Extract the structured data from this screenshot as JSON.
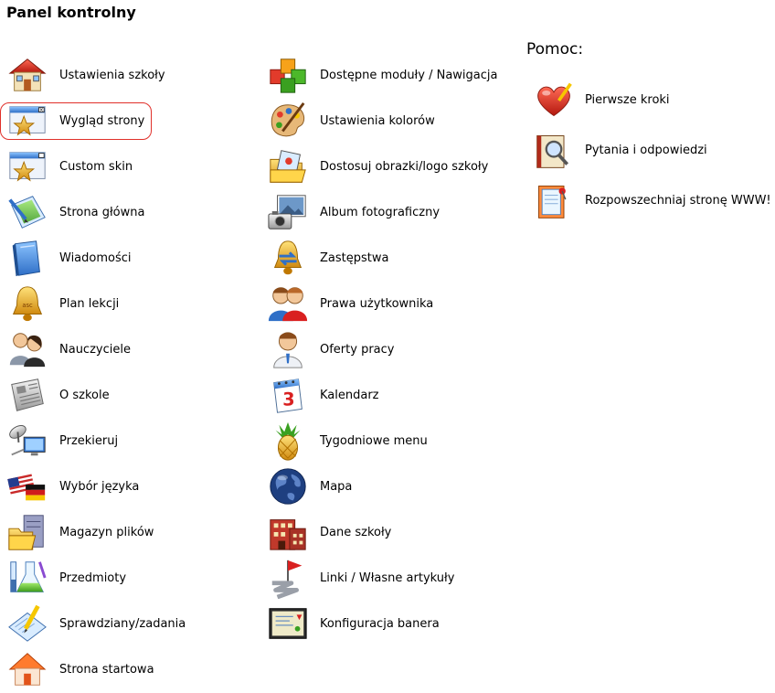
{
  "page": {
    "title": "Panel kontrolny"
  },
  "help": {
    "heading": "Pomoc:",
    "items": [
      {
        "label": "Pierwsze kroki",
        "icon": "heart-pencil-icon"
      },
      {
        "label": "Pytania i odpowiedzi",
        "icon": "book-magnifier-icon"
      },
      {
        "label": "Rozpowszechniaj stronę WWW!",
        "icon": "notepad-pin-icon"
      }
    ]
  },
  "column1": [
    {
      "label": "Ustawienia szkoły",
      "icon": "house-icon"
    },
    {
      "label": "Wygląd strony",
      "icon": "window-star-icon",
      "highlighted": true
    },
    {
      "label": "Custom skin",
      "icon": "window-star-icon"
    },
    {
      "label": "Strona główna",
      "icon": "document-pencil-icon"
    },
    {
      "label": "Wiadomości",
      "icon": "blue-book-icon"
    },
    {
      "label": "Plan lekcji",
      "icon": "bell-icon"
    },
    {
      "label": "Nauczyciele",
      "icon": "people-icon"
    },
    {
      "label": "O szkole",
      "icon": "newspaper-icon"
    },
    {
      "label": "Przekieruj",
      "icon": "satellite-monitor-icon"
    },
    {
      "label": "Wybór języka",
      "icon": "flags-icon"
    },
    {
      "label": "Magazyn plików",
      "icon": "file-server-icon"
    },
    {
      "label": "Przedmioty",
      "icon": "flask-pencil-icon"
    },
    {
      "label": "Sprawdziany/zadania",
      "icon": "paper-pencil-icon"
    },
    {
      "label": "Strona startowa",
      "icon": "house-icon"
    }
  ],
  "column2": [
    {
      "label": "Dostępne moduły / Nawigacja",
      "icon": "cubes-icon"
    },
    {
      "label": "Ustawienia kolorów",
      "icon": "palette-icon"
    },
    {
      "label": "Dostosuj obrazki/logo szkoły",
      "icon": "folder-image-icon"
    },
    {
      "label": "Album fotograficzny",
      "icon": "camera-photo-icon"
    },
    {
      "label": "Zastępstwa",
      "icon": "bell-arrows-icon"
    },
    {
      "label": "Prawa użytkownika",
      "icon": "users-icon"
    },
    {
      "label": "Oferty pracy",
      "icon": "worker-icon"
    },
    {
      "label": "Kalendarz",
      "icon": "calendar-icon"
    },
    {
      "label": "Tygodniowe menu",
      "icon": "pineapple-icon"
    },
    {
      "label": "Mapa",
      "icon": "globe-icon"
    },
    {
      "label": "Dane szkoły",
      "icon": "building-icon"
    },
    {
      "label": "Linki / Własne artykuły",
      "icon": "flag-link-icon"
    },
    {
      "label": "Konfiguracja banera",
      "icon": "banner-icon"
    }
  ],
  "colors": {
    "highlight": "#e0302a",
    "text": "#000000",
    "background": "#ffffff"
  }
}
